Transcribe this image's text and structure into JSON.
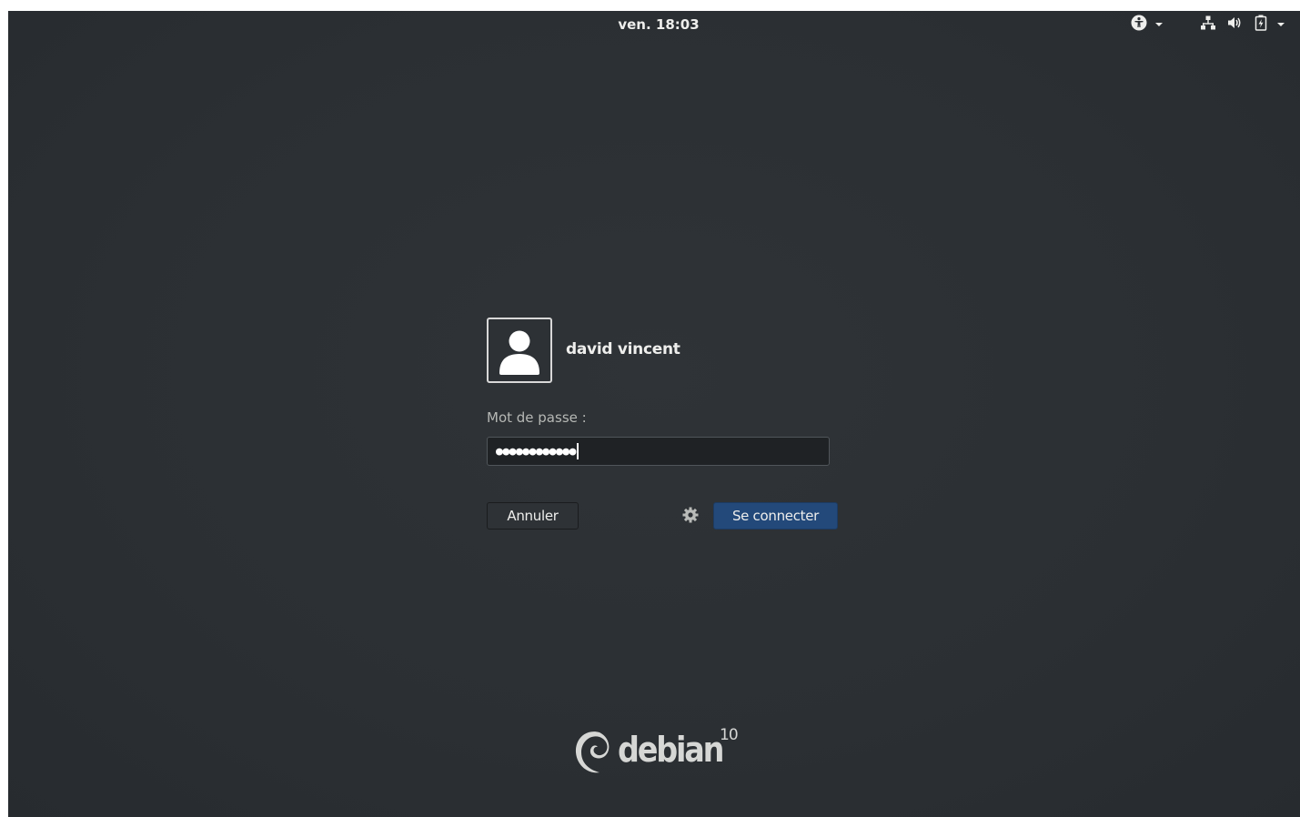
{
  "topbar": {
    "clock": "ven. 18:03",
    "tray": {
      "accessibility": "accessibility-icon",
      "network": "network-wired-icon",
      "volume": "volume-icon",
      "battery": "battery-charging-icon"
    }
  },
  "login": {
    "avatar_icon": "user-avatar-icon",
    "username": "david vincent",
    "password_label": "Mot de passe :",
    "password_mask": "●●●●●●●●●●●●",
    "cancel_label": "Annuler",
    "connect_label": "Se connecter",
    "session_icon": "gear-icon"
  },
  "branding": {
    "name": "debian",
    "version": "10"
  },
  "colors": {
    "background": "#2c3034",
    "accent": "#23497a",
    "text": "#eeeeec"
  }
}
